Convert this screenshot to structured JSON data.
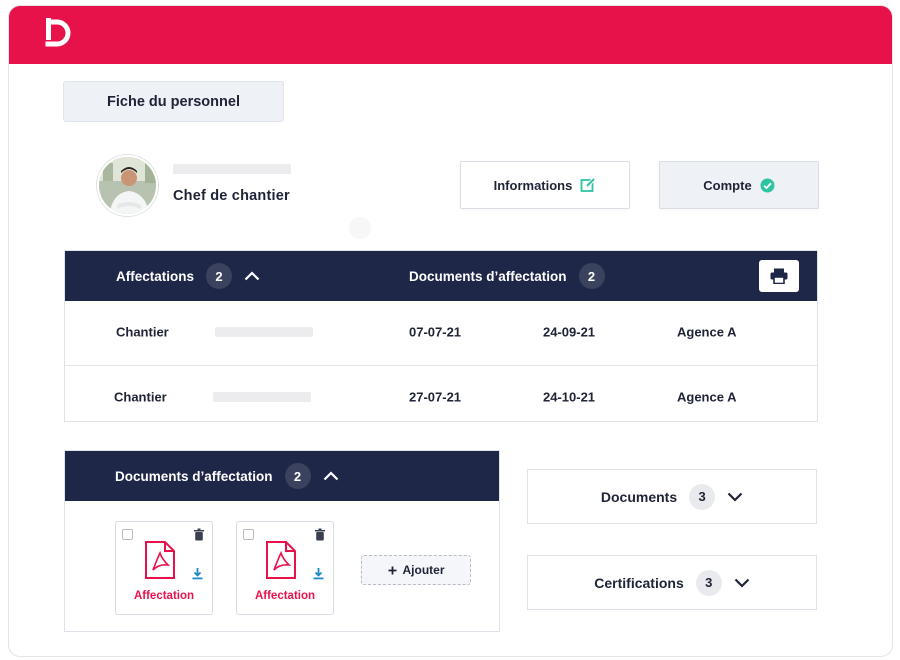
{
  "header": {
    "logo_icon": "brand-logo-icon",
    "brand_color": "#e8124b"
  },
  "personnel_button": {
    "label": "Fiche du personnel"
  },
  "profile": {
    "role": "Chef de chantier",
    "avatar_icon": "person-avatar"
  },
  "actions": {
    "informations": {
      "label": "Informations",
      "icon": "edit-icon",
      "icon_color": "#2ec4a0"
    },
    "compte": {
      "label": "Compte",
      "icon": "check-circle-icon",
      "icon_color": "#2ec4a0"
    }
  },
  "affectations_panel": {
    "title": "Affectations",
    "count": "2",
    "documents_title": "Documents d’affectation",
    "documents_count": "2",
    "print_icon": "printer-icon",
    "rows": [
      {
        "label": "Chantier",
        "start": "07-07-21",
        "end": "24-09-21",
        "agency": "Agence A"
      },
      {
        "label": "Chantier",
        "start": "27-07-21",
        "end": "24-10-21",
        "agency": "Agence A"
      }
    ]
  },
  "documents_panel": {
    "title": "Documents d’affectation",
    "count": "2",
    "files": [
      {
        "label": "Affectation",
        "icon": "pdf-file-icon"
      },
      {
        "label": "Affectation",
        "icon": "pdf-file-icon"
      }
    ],
    "add_label": "Ajouter"
  },
  "side_cards": [
    {
      "label": "Documents",
      "count": "3"
    },
    {
      "label": "Certifications",
      "count": "3"
    }
  ],
  "colors": {
    "navy": "#1f2749",
    "accent_red": "#e8124b",
    "accent_green": "#2ec4a0"
  }
}
